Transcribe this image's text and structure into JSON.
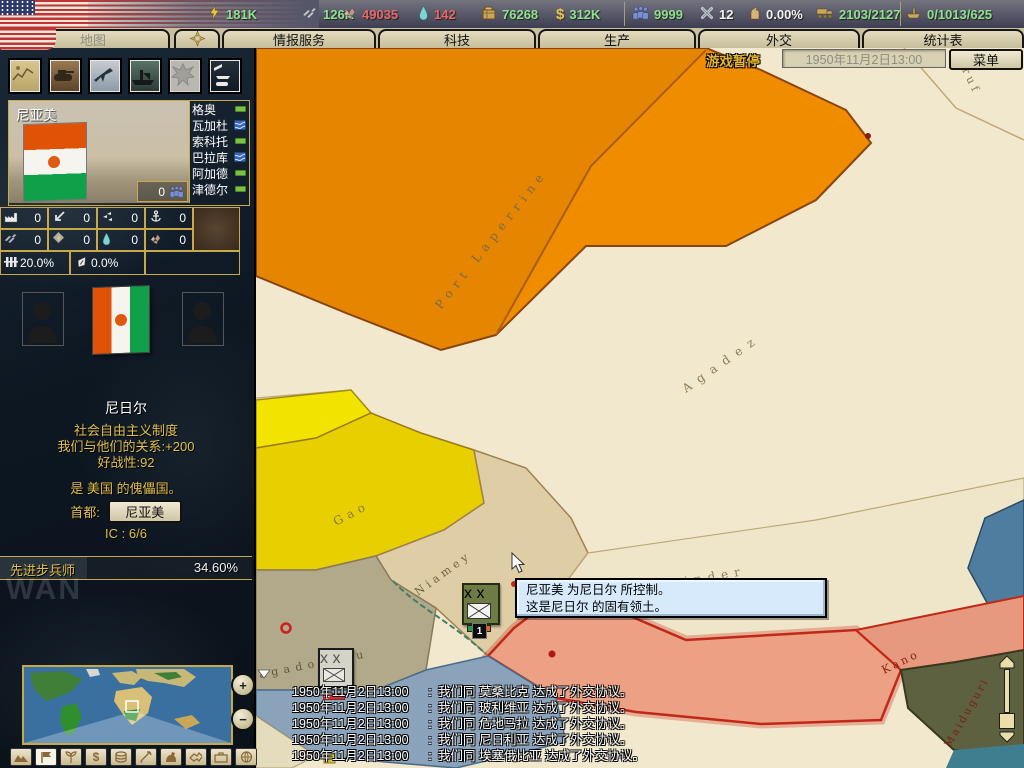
{
  "top_bar": {
    "resources": [
      {
        "id": "energy",
        "value": "181K",
        "color": "#8fe08f"
      },
      {
        "id": "metal",
        "value": "126K",
        "color": "#8fe08f"
      },
      {
        "id": "rare_materials",
        "value": "49035",
        "color": "#e86868"
      },
      {
        "id": "oil",
        "value": "142",
        "color": "#e86868"
      },
      {
        "id": "supplies",
        "value": "76268",
        "color": "#8fe08f"
      },
      {
        "id": "money",
        "value": "312K",
        "color": "#8fe08f"
      },
      {
        "id": "manpower",
        "value": "9999",
        "color": "#8fe08f"
      },
      {
        "id": "transports",
        "value": "12",
        "color": "#f2f2f2"
      },
      {
        "id": "dissent",
        "value": "0.00%",
        "color": "#f2f2f2"
      },
      {
        "id": "convoys",
        "value": "2103/2127",
        "color": "#8fe08f"
      },
      {
        "id": "escorts",
        "value": "0/1013/625",
        "color": "#8fe08f"
      }
    ]
  },
  "tab_bar": {
    "tabs": [
      {
        "label": "地图"
      },
      {
        "label": "情报服务"
      },
      {
        "label": "科技"
      },
      {
        "label": "生产"
      },
      {
        "label": "外交"
      },
      {
        "label": "统计表"
      }
    ]
  },
  "map_controls": {
    "pause_label": "游戏暂停",
    "date": "1950年11月2日13:00",
    "menu_label": "菜单"
  },
  "sidebar": {
    "province": {
      "name": "尼亚美",
      "manpower": "0",
      "adjacent": [
        {
          "label": "格奥",
          "crossing": "land"
        },
        {
          "label": "瓦加杜",
          "crossing": "river"
        },
        {
          "label": "索科托",
          "crossing": "land"
        },
        {
          "label": "巴拉库",
          "crossing": "river"
        },
        {
          "label": "阿加德",
          "crossing": "land"
        },
        {
          "label": "津德尔",
          "crossing": "land"
        }
      ],
      "stats": [
        {
          "id": "factory",
          "value": "0"
        },
        {
          "id": "anti_air",
          "value": "0"
        },
        {
          "id": "air_base",
          "value": "0"
        },
        {
          "id": "naval_base",
          "value": "0"
        },
        {
          "id": "metal",
          "value": "0"
        },
        {
          "id": "energy",
          "value": "0"
        },
        {
          "id": "oil",
          "value": "0"
        },
        {
          "id": "rare_materials",
          "value": "0"
        }
      ],
      "infrastructure": "20.0%",
      "revolt_risk": "0.0%"
    },
    "country": {
      "name": "尼日尔",
      "government": "社会自由主义制度",
      "relations": "我们与他们的关系:+200",
      "belligerence": "好战性:92",
      "puppet": "是 美国 的傀儡国。",
      "capital_label": "首都:",
      "capital": "尼亚美",
      "ic": "IC : 6/6"
    },
    "research": {
      "name": "先进步兵师",
      "progress": "34.60%"
    },
    "watermark": "WAN"
  },
  "map": {
    "labels": {
      "port_laperrine": "Port Laperrine",
      "agadez": "Agadez",
      "gao": "Gao",
      "niamey": "Niamey",
      "zinder": "Zinder",
      "kano": "Kano",
      "maiduguri": "Maiduguri",
      "ouagadougou": "agadougou",
      "corner": "ruf"
    },
    "unit_count": "1",
    "tooltip": {
      "line1": "尼亚美 为尼日尔 所控制。",
      "line2": "这是尼日尔 的固有领土。"
    },
    "messages": [
      {
        "time": "1950年11月2日13:00",
        "sep": ":",
        "text": "我们同 莫桑比克 达成了外交协议。"
      },
      {
        "time": "1950年11月2日13:00",
        "sep": ":",
        "text": "我们同 玻利维亚 达成了外交协议。"
      },
      {
        "time": "1950年11月2日13:00",
        "sep": ":",
        "text": "我们同 危地马拉 达成了外交协议。"
      },
      {
        "time": "1950年11月2日13:00",
        "sep": ":",
        "text": "我们同 尼日利亚 达成了外交协议。"
      },
      {
        "time": "1950年11月2日13:00",
        "sep": ":",
        "text": "我们同 埃塞俄比亚 达成了外交协议。"
      }
    ]
  }
}
